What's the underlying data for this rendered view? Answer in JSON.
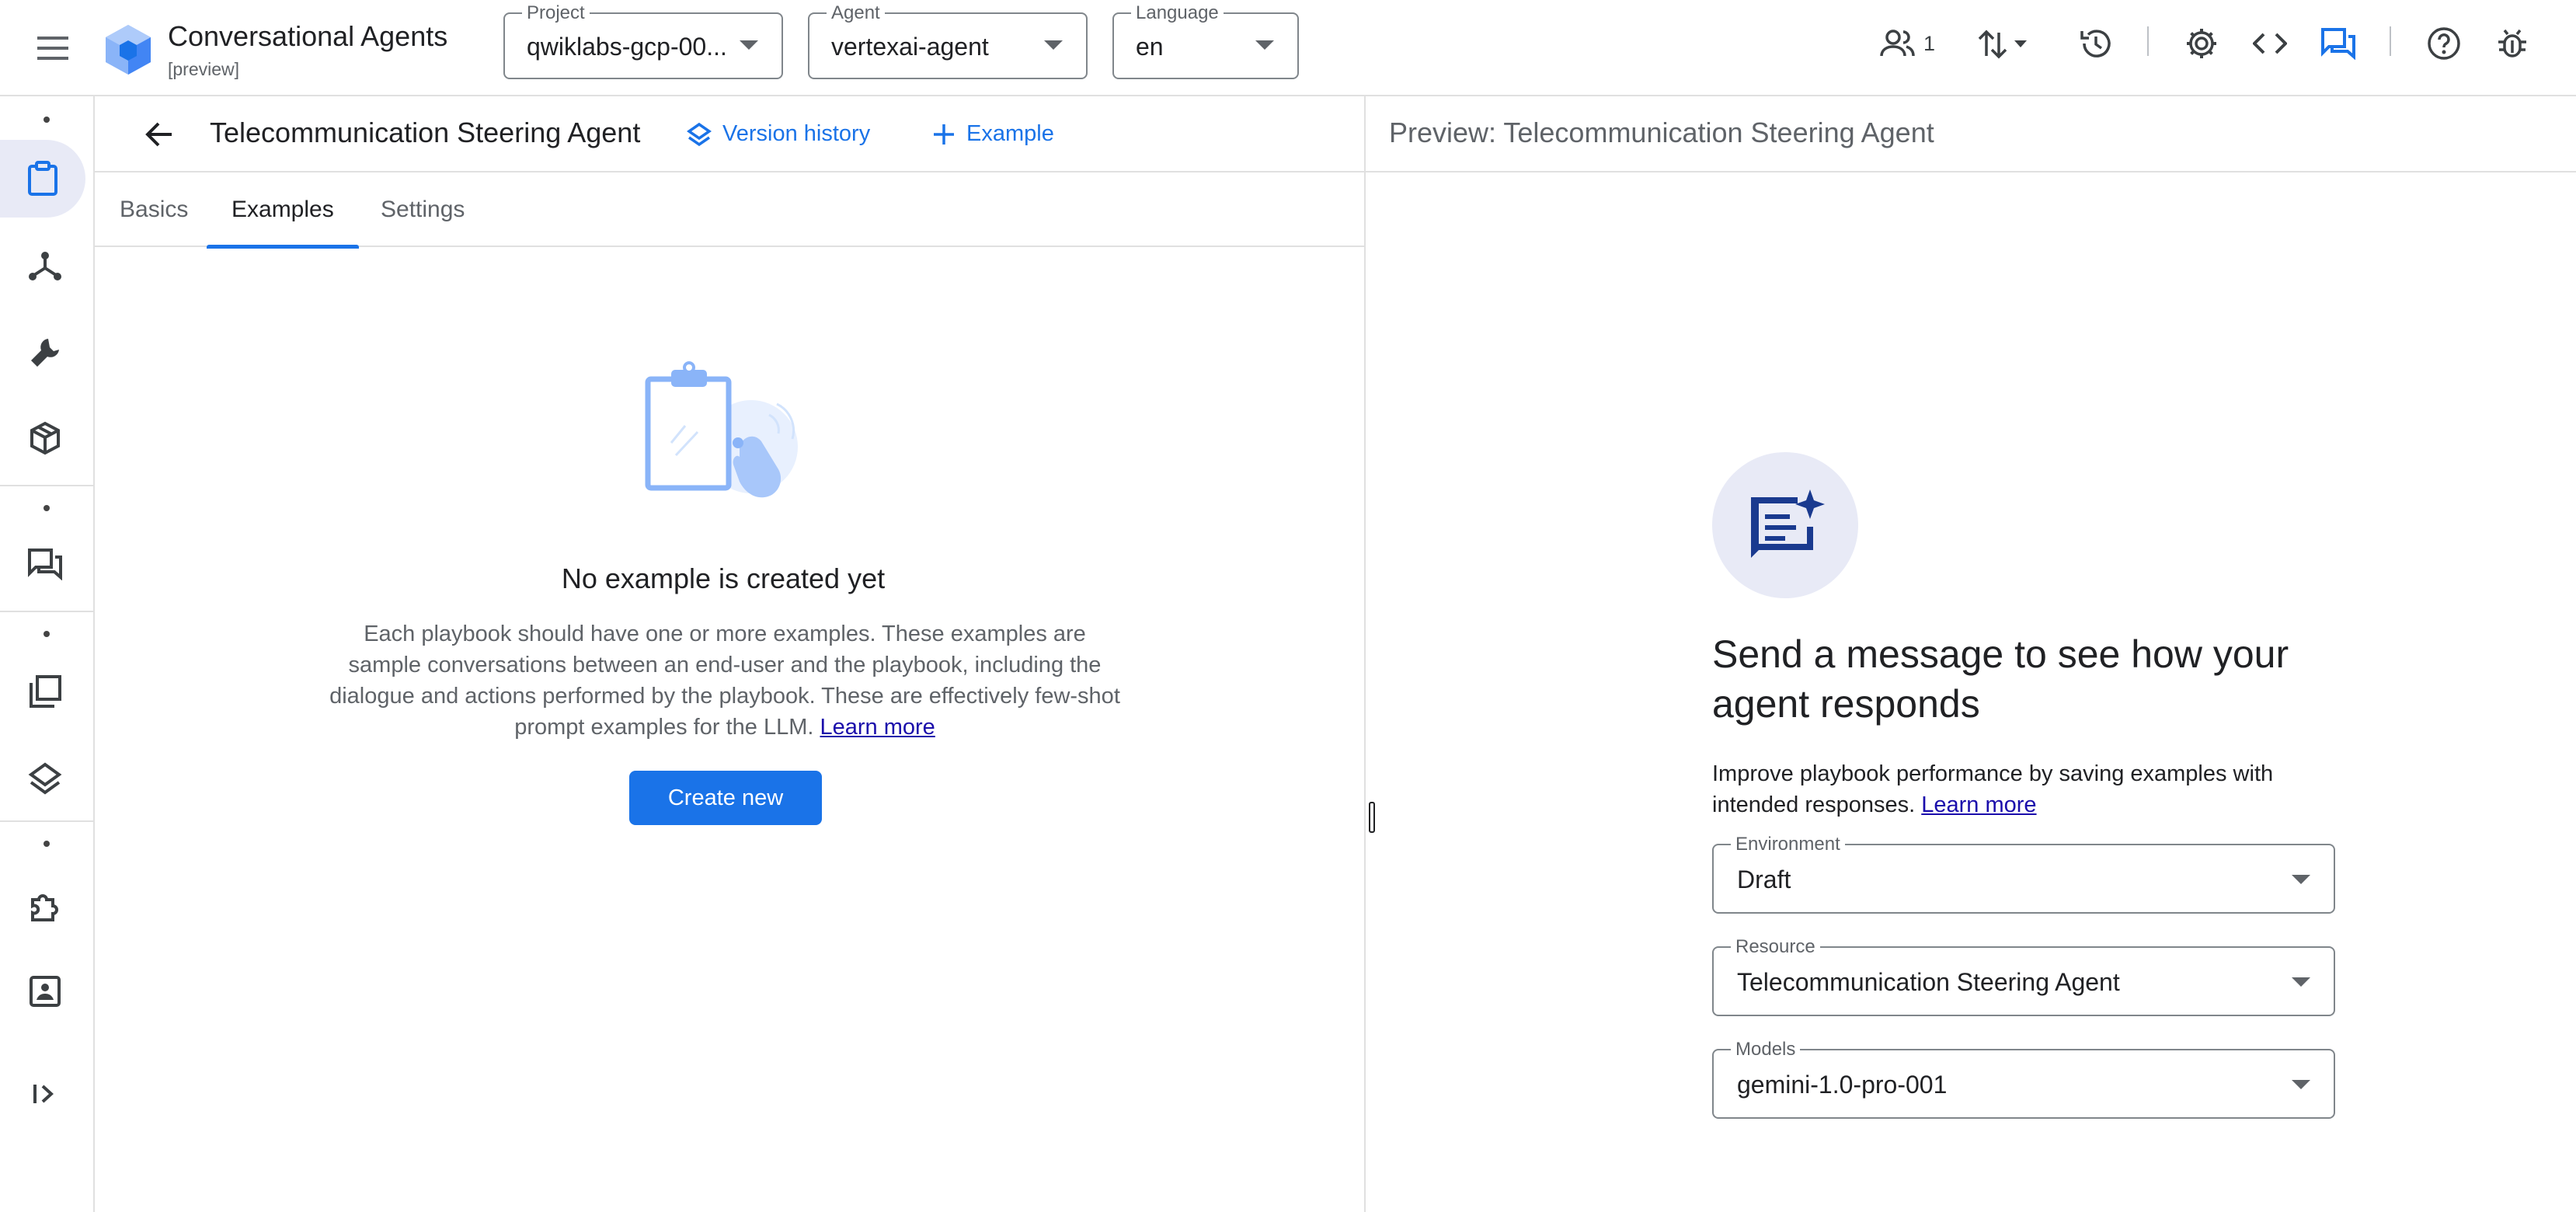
{
  "app": {
    "title": "Conversational Agents",
    "subtitle": "[preview]"
  },
  "topbar": {
    "project": {
      "label": "Project",
      "value": "qwiklabs-gcp-00..."
    },
    "agent": {
      "label": "Agent",
      "value": "vertexai-agent"
    },
    "language": {
      "label": "Language",
      "value": "en"
    },
    "users_count": "1"
  },
  "editor": {
    "title": "Telecommunication Steering Agent",
    "version_history": "Version history",
    "add_example": "Example",
    "tabs": [
      "Basics",
      "Examples",
      "Settings"
    ],
    "active_tab": "Examples",
    "empty": {
      "title": "No example is created yet",
      "description": "Each playbook should have one or more examples. These examples are sample conversations between an end-user and the playbook, including the dialogue and actions performed by the playbook. These are effectively few-shot prompt examples for the LLM.",
      "learn_more": "Learn more",
      "create_button": "Create new"
    }
  },
  "preview": {
    "title": "Preview: Telecommunication Steering Agent",
    "headline": "Send a message to see how your agent responds",
    "subtext": "Improve playbook performance by saving examples with intended responses.",
    "learn_more": "Learn more",
    "environment": {
      "label": "Environment",
      "value": "Draft"
    },
    "resource": {
      "label": "Resource",
      "value": "Telecommunication Steering Agent"
    },
    "models": {
      "label": "Models",
      "value": "gemini-1.0-pro-001"
    }
  },
  "colors": {
    "accent": "#1a73e8",
    "icon": "#3c4043",
    "active_bg": "#e8eaf6"
  }
}
